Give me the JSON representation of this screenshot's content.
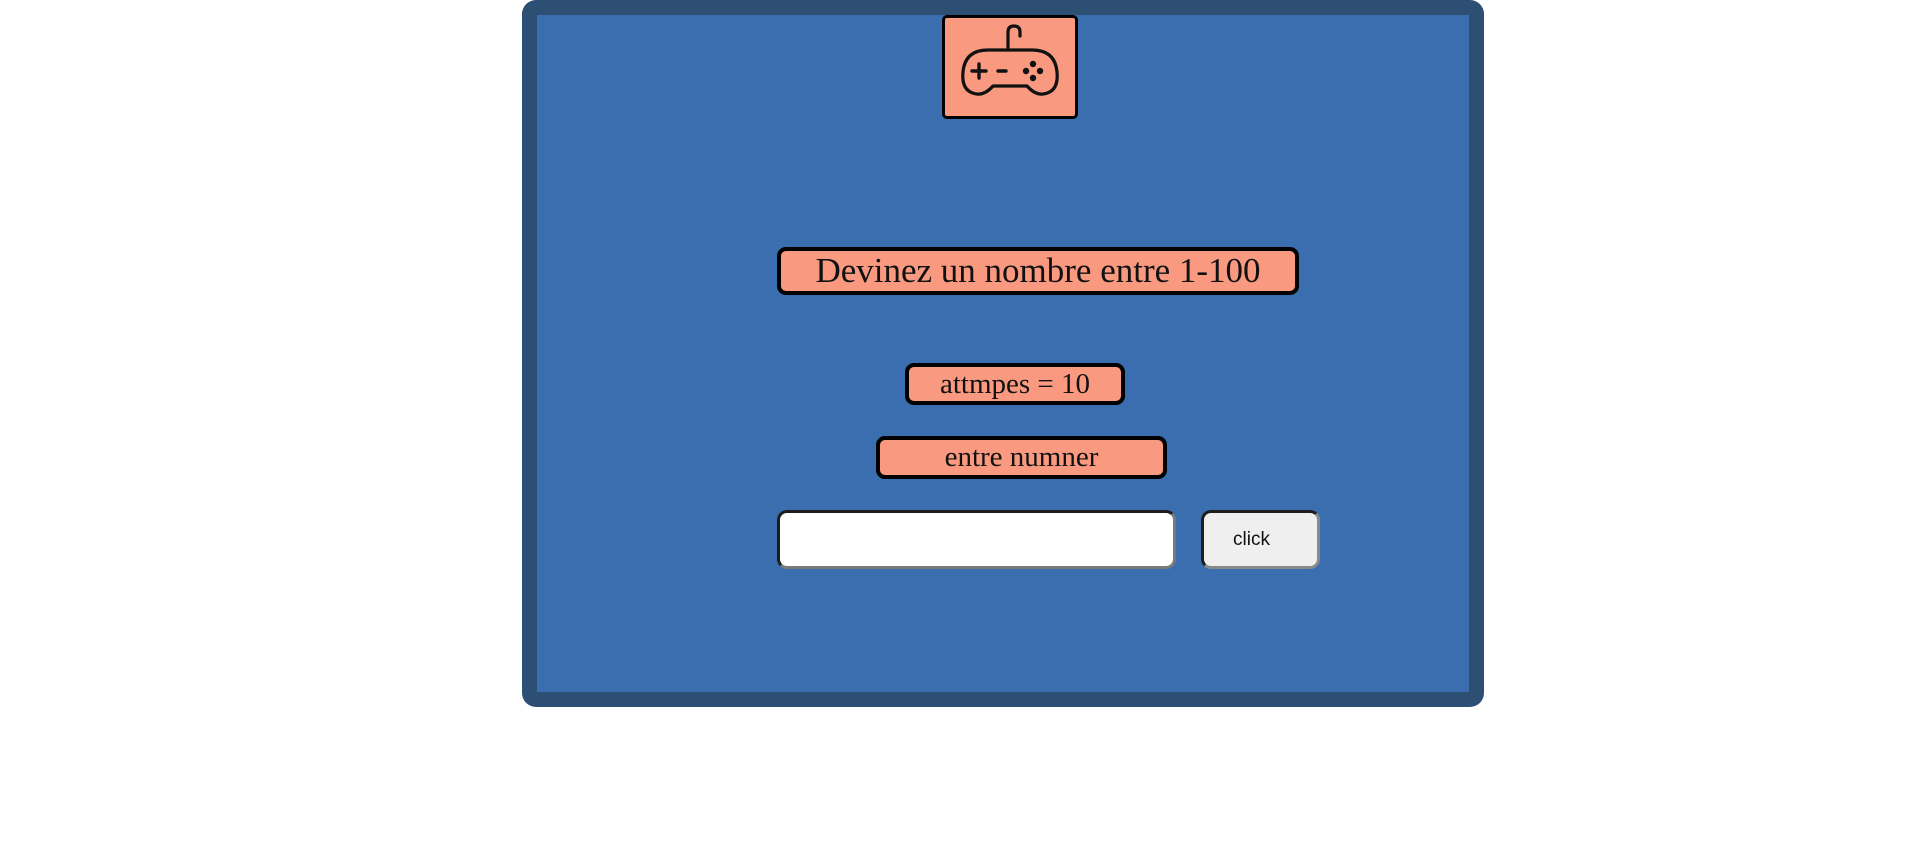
{
  "game": {
    "icon": "gamepad-icon",
    "title": "Devinez un nombre entre 1-100",
    "attempts_text": "attmpes = 10",
    "prompt_text": "entre numner",
    "input": {
      "value": "",
      "placeholder": ""
    },
    "button_label": "click"
  },
  "colors": {
    "page_background": "#ffffff",
    "panel_background": "#3a6eaf",
    "panel_border": "#2d4f74",
    "pill_background": "#f99a80",
    "pill_border": "#000000",
    "button_background": "#efefef"
  }
}
